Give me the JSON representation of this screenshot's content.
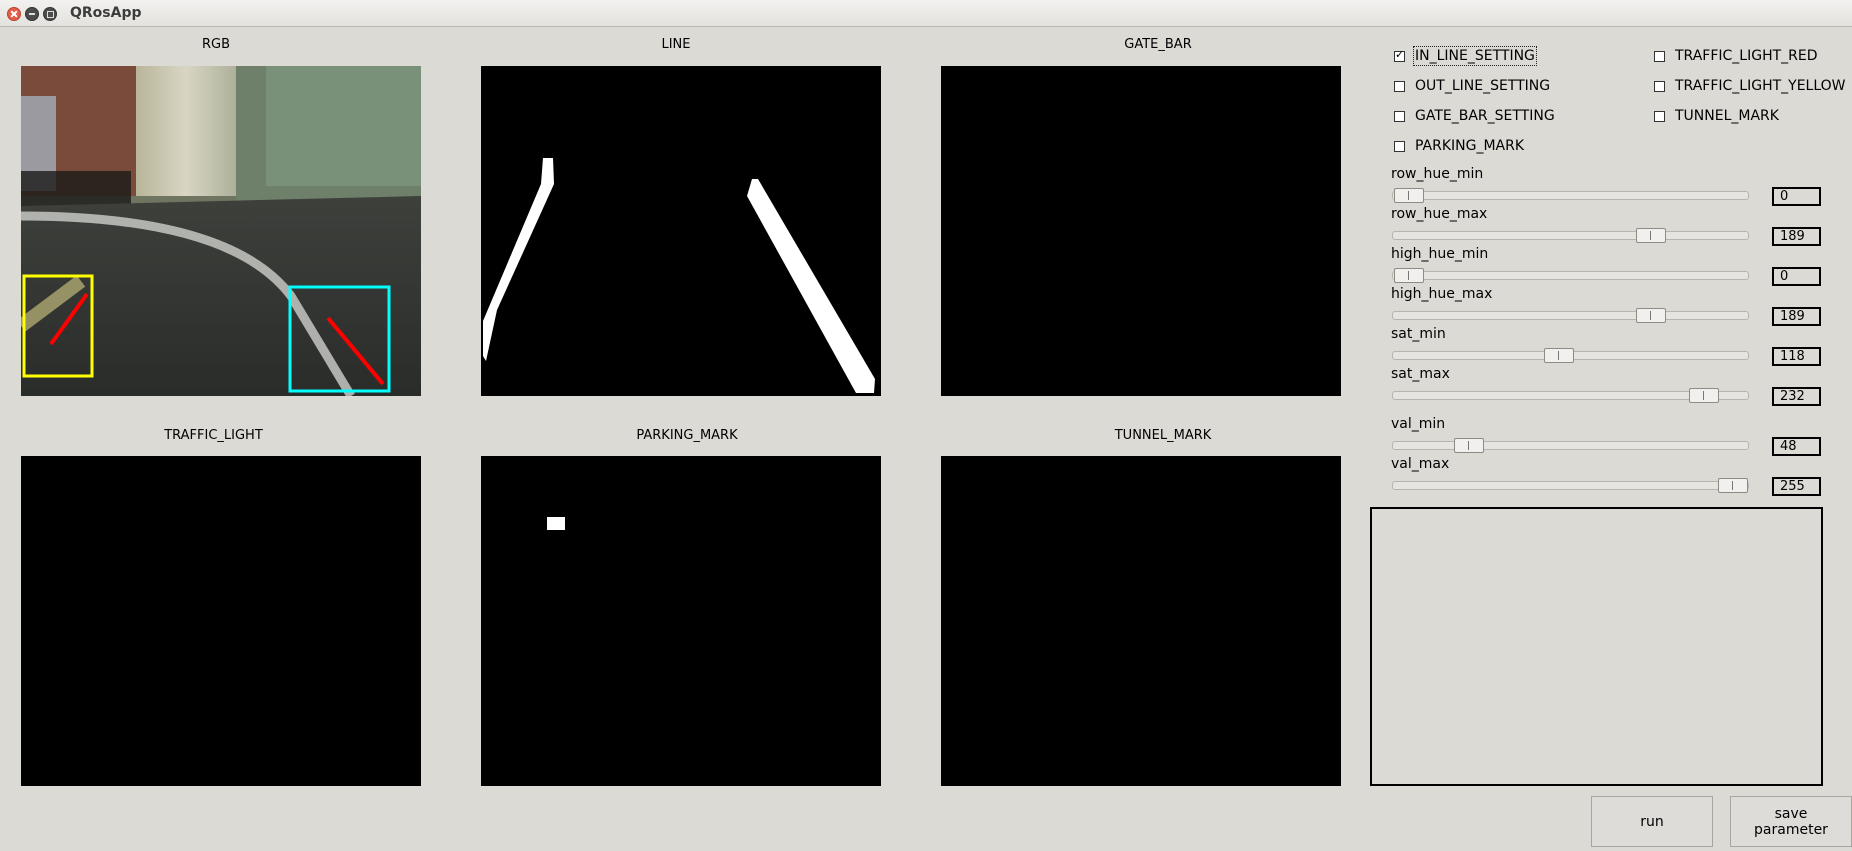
{
  "window": {
    "title": "QRosApp"
  },
  "panels": {
    "rgb": "RGB",
    "line": "LINE",
    "gate_bar": "GATE_BAR",
    "traffic_light": "TRAFFIC_LIGHT",
    "parking_mark": "PARKING_MARK",
    "tunnel_mark": "TUNNEL_MARK"
  },
  "checkboxes": {
    "in_line_setting": {
      "label": "IN_LINE_SETTING",
      "checked": true
    },
    "out_line_setting": {
      "label": "OUT_LINE_SETTING",
      "checked": false
    },
    "gate_bar_setting": {
      "label": "GATE_BAR_SETTING",
      "checked": false
    },
    "parking_mark": {
      "label": "PARKING_MARK",
      "checked": false
    },
    "traffic_light_red": {
      "label": "TRAFFIC_LIGHT_RED",
      "checked": false
    },
    "traffic_light_yellow": {
      "label": "TRAFFIC_LIGHT_YELLOW",
      "checked": false
    },
    "tunnel_mark": {
      "label": "TUNNEL_MARK",
      "checked": false
    }
  },
  "sliders": {
    "row_hue_min": {
      "label": "row_hue_min",
      "value": "0"
    },
    "row_hue_max": {
      "label": "row_hue_max",
      "value": "189"
    },
    "high_hue_min": {
      "label": "high_hue_min",
      "value": "0"
    },
    "high_hue_max": {
      "label": "high_hue_max",
      "value": "189"
    },
    "sat_min": {
      "label": "sat_min",
      "value": "118"
    },
    "sat_max": {
      "label": "sat_max",
      "value": "232"
    },
    "val_min": {
      "label": "val_min",
      "value": "48"
    },
    "val_max": {
      "label": "val_max",
      "value": "255"
    }
  },
  "buttons": {
    "run": "run",
    "save_parameter": "save parameter"
  },
  "colors": {
    "background": "#dcdad5",
    "rgb_box_left": "#ffff00",
    "rgb_box_right": "#00ffff",
    "lane_marker": "#ff0000"
  }
}
